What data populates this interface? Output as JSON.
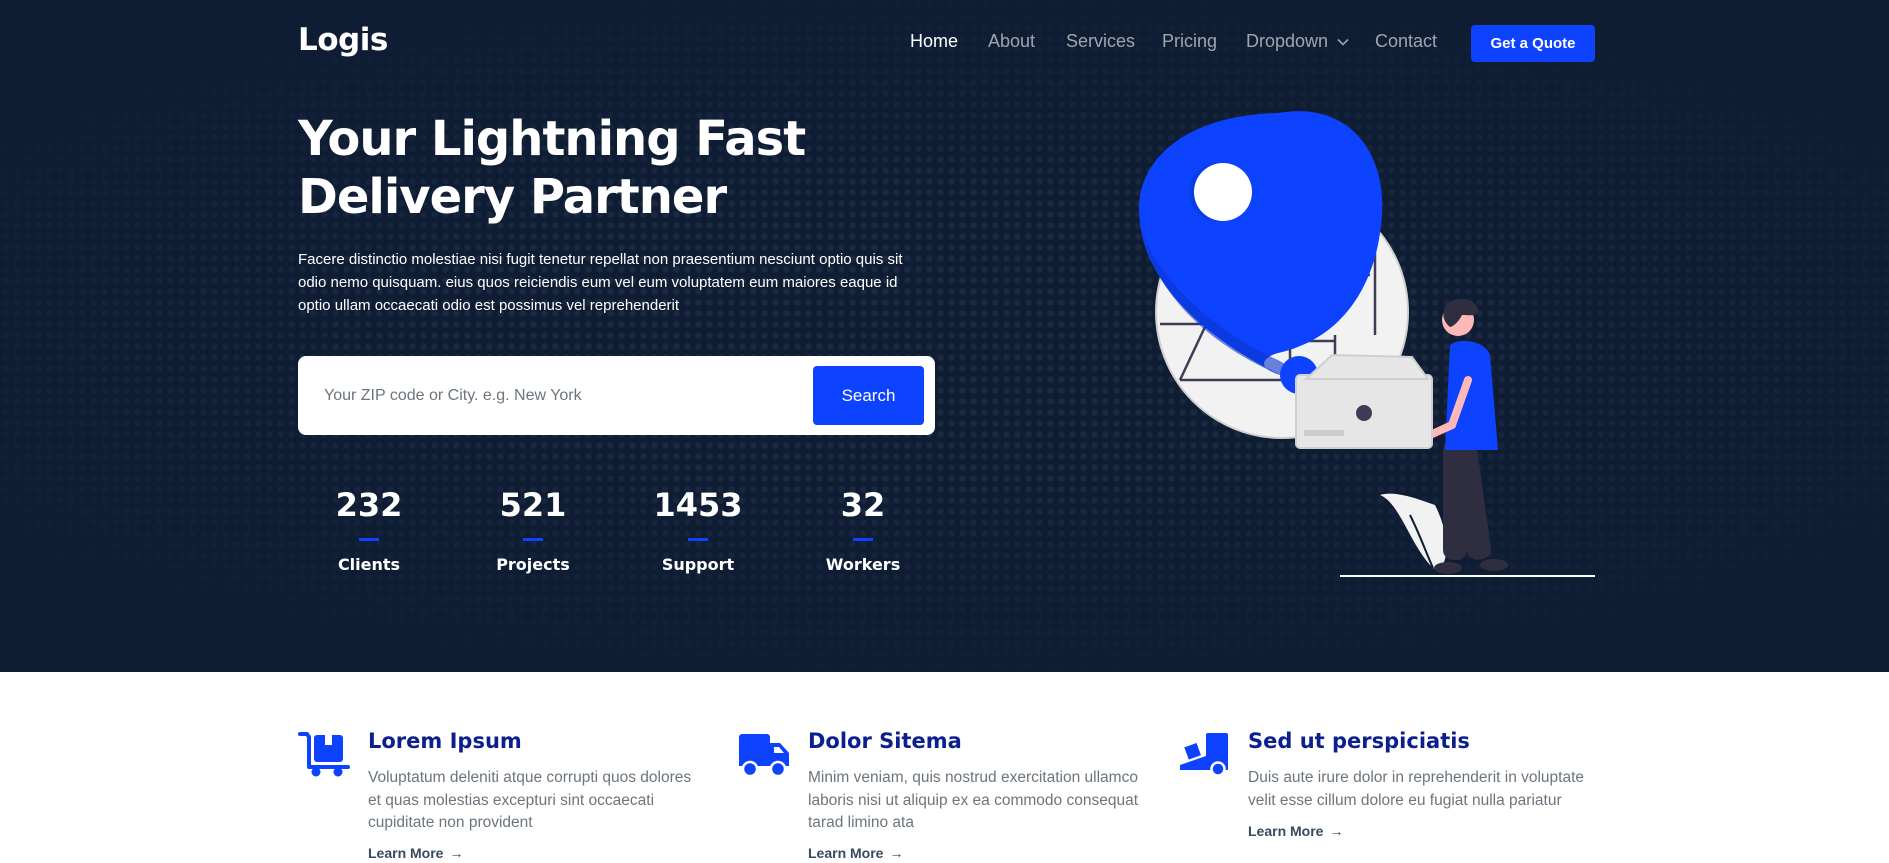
{
  "brand": {
    "logo": "Logis"
  },
  "nav": {
    "items": [
      {
        "label": "Home",
        "active": true
      },
      {
        "label": "About",
        "active": false
      },
      {
        "label": "Services",
        "active": false
      },
      {
        "label": "Pricing",
        "active": false
      },
      {
        "label": "Dropdown",
        "active": false,
        "has_dropdown": true
      },
      {
        "label": "Contact",
        "active": false
      }
    ],
    "cta_label": "Get a Quote"
  },
  "hero": {
    "title_line1": "Your Lightning Fast",
    "title_line2": "Delivery Partner",
    "description": "Facere distinctio molestiae nisi fugit tenetur repellat non praesentium nesciunt optio quis sit odio nemo quisquam. eius quos reiciendis eum vel eum voluptatem eum maiores eaque id optio ullam occaecati odio est possimus vel reprehenderit",
    "search": {
      "placeholder": "Your ZIP code or City. e.g. New York",
      "value": "",
      "button_label": "Search"
    },
    "stats": [
      {
        "value": "232",
        "label": "Clients"
      },
      {
        "value": "521",
        "label": "Projects"
      },
      {
        "value": "1453",
        "label": "Support"
      },
      {
        "value": "32",
        "label": "Workers"
      }
    ]
  },
  "features": [
    {
      "icon": "cart-flatbed-boxes-icon",
      "title": "Lorem Ipsum",
      "description": "Voluptatum deleniti atque corrupti quos dolores et quas molestias excepturi sint occaecati cupiditate non provident",
      "link_label": "Learn More"
    },
    {
      "icon": "truck-icon",
      "title": "Dolor Sitema",
      "description": "Minim veniam, quis nostrud exercitation ullamco laboris nisi ut aliquip ex ea commodo consequat tarad limino ata",
      "link_label": "Learn More"
    },
    {
      "icon": "truck-ramp-box-icon",
      "title": "Sed ut perspiciatis",
      "description": "Duis aute irure dolor in reprehenderit in voluptate velit esse cillum dolore eu fugiat nulla pariatur",
      "link_label": "Learn More"
    }
  ],
  "colors": {
    "hero_bg": "#0e1d34",
    "accent": "#0d42ff",
    "feature_title": "#0c1f8f",
    "body_text": "#6c757d"
  }
}
